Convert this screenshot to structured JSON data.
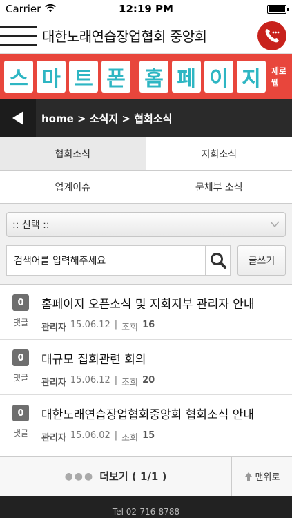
{
  "status_bar": {
    "carrier": "Carrier",
    "time": "12:19 PM",
    "battery_percent": 100
  },
  "header": {
    "title": "대한노래연습장업협회 중앙회"
  },
  "banner": {
    "tiles": [
      "스",
      "마",
      "트",
      "폰",
      "홈",
      "페",
      "이",
      "지"
    ],
    "brand": "제로웹"
  },
  "breadcrumb": {
    "text": "home >  소식지 > 협회소식"
  },
  "tabs": [
    {
      "label": "협회소식",
      "active": true
    },
    {
      "label": "지회소식",
      "active": false
    },
    {
      "label": "업계이슈",
      "active": false
    },
    {
      "label": "문체부 소식",
      "active": false
    }
  ],
  "filter": {
    "select_value": ":: 선택 ::",
    "search_placeholder": "검색어를 입력해주세요",
    "write_label": "글쓰기"
  },
  "posts": [
    {
      "comments": "0",
      "comment_label": "댓글",
      "title": "홈페이지 오픈소식 및 지회지부 관리자 안내",
      "author": "관리자",
      "date": "15.06.12",
      "views_label": "조회",
      "views": "16"
    },
    {
      "comments": "0",
      "comment_label": "댓글",
      "title": "대규모 집회관련 회의",
      "author": "관리자",
      "date": "15.06.12",
      "views_label": "조회",
      "views": "20"
    },
    {
      "comments": "0",
      "comment_label": "댓글",
      "title": "대한노래연습장업협회중앙회 협회소식 안내",
      "author": "관리자",
      "date": "15.06.02",
      "views_label": "조회",
      "views": "15"
    }
  ],
  "footer": {
    "more_label": "더보기  ( 1/1 )",
    "top_label": "맨위로",
    "tel": "Tel 02-716-8788"
  }
}
